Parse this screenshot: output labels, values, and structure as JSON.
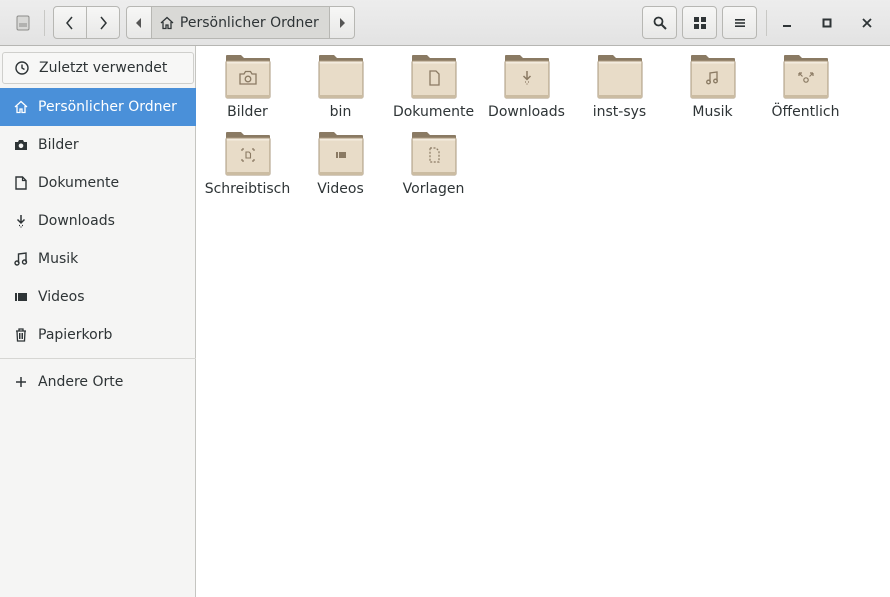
{
  "header": {
    "path_current": "Persönlicher Ordner"
  },
  "sidebar": {
    "items": [
      {
        "label": "Zuletzt verwendet",
        "icon": "clock-icon"
      },
      {
        "label": "Persönlicher Ordner",
        "icon": "home-icon",
        "active": true
      },
      {
        "label": "Bilder",
        "icon": "camera-icon"
      },
      {
        "label": "Dokumente",
        "icon": "document-icon"
      },
      {
        "label": "Downloads",
        "icon": "download-icon"
      },
      {
        "label": "Musik",
        "icon": "music-icon"
      },
      {
        "label": "Videos",
        "icon": "video-icon"
      },
      {
        "label": "Papierkorb",
        "icon": "trash-icon"
      },
      {
        "label": "Andere Orte",
        "icon": "plus-icon"
      }
    ]
  },
  "files": [
    {
      "name": "Bilder",
      "emblem": "camera"
    },
    {
      "name": "bin",
      "emblem": "none"
    },
    {
      "name": "Dokumente",
      "emblem": "document"
    },
    {
      "name": "Downloads",
      "emblem": "download"
    },
    {
      "name": "inst-sys",
      "emblem": "none"
    },
    {
      "name": "Musik",
      "emblem": "music"
    },
    {
      "name": "Öffentlich",
      "emblem": "share"
    },
    {
      "name": "Schreibtisch",
      "emblem": "desktop"
    },
    {
      "name": "Videos",
      "emblem": "video"
    },
    {
      "name": "Vorlagen",
      "emblem": "template"
    }
  ],
  "colors": {
    "accent": "#4a90d9",
    "folder_body": "#e8dcc8",
    "folder_tab": "#8a7a63"
  }
}
